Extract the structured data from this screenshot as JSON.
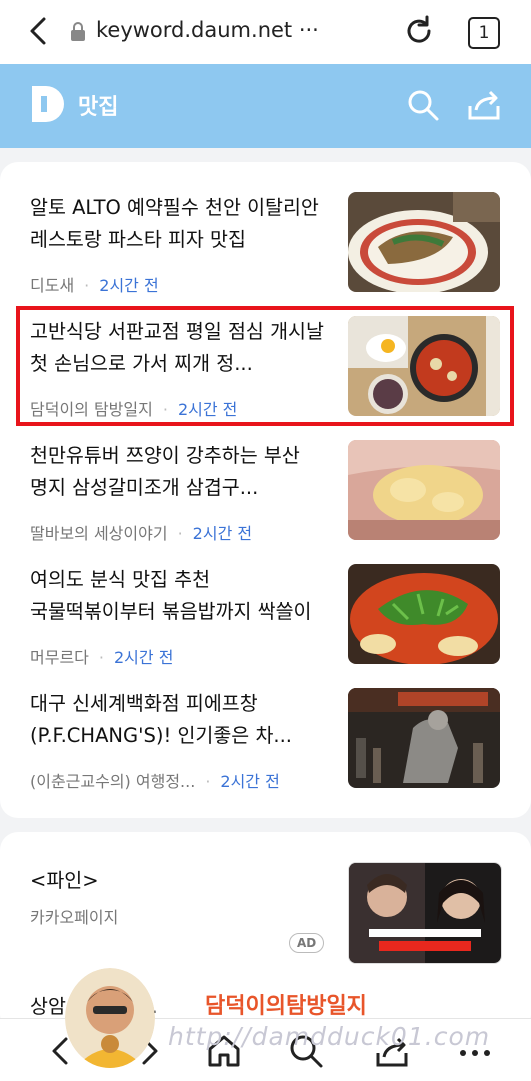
{
  "browser": {
    "url": "keyword.daum.net ···",
    "tab_count": "1"
  },
  "header": {
    "title": "맛집"
  },
  "articles": [
    {
      "title": "알토 ALTO 예약필수 천안 이탈리안 레스토랑 파스타 피자 맛집",
      "source": "디도새",
      "time": "2시간 전"
    },
    {
      "title": "고반식당 서판교점 평일 점심 개시날 첫 손님으로 가서 찌개 정...",
      "source": "담덕이의 탐방일지",
      "time": "2시간 전"
    },
    {
      "title": "천만유튜버 쯔양이 강추하는 부산 명지 삼성갈미조개 삼겹구...",
      "source": "딸바보의 세상이야기",
      "time": "2시간 전"
    },
    {
      "title": "여의도 분식 맛집 추천 국물떡볶이부터 볶음밥까지 싹쓸이",
      "source": "머무르다",
      "time": "2시간 전"
    },
    {
      "title": "대구 신세계백화점 피에프창 (P.F.CHANG'S)! 인기좋은 차...",
      "source": "(이춘근교수의) 여행정...",
      "time": "2시간 전"
    }
  ],
  "ad": {
    "title": "<파인>",
    "advertiser": "카카오페이지",
    "badge": "AD"
  },
  "next_item": {
    "title": "상암 ... 회식 ..."
  },
  "watermark": {
    "name": "담덕이의탐방일지",
    "url": "http://damdduck01.com"
  },
  "colors": {
    "header_bg": "#8ec8f0",
    "time_blue": "#3b73d6",
    "highlight_red": "#e8141b"
  }
}
